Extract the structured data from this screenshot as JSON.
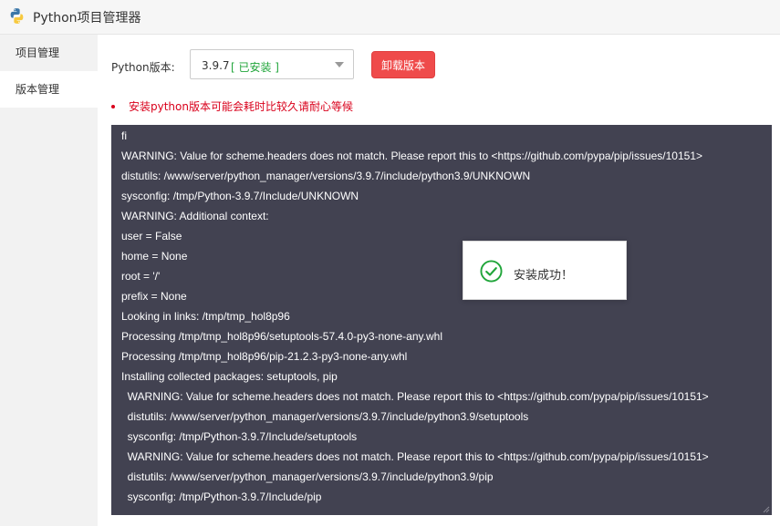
{
  "window": {
    "title": "Python项目管理器",
    "icon": "python-logo-icon"
  },
  "sidebar": {
    "items": [
      {
        "label": "项目管理",
        "active": false
      },
      {
        "label": "版本管理",
        "active": true
      }
    ]
  },
  "version_control": {
    "label": "Python版本:",
    "selected_version": "3.9.7",
    "selected_status": "[ 已安装 ]",
    "status_color": "#20a53a",
    "uninstall_label": "卸载版本",
    "uninstall_color": "#ef4b4b"
  },
  "notice": {
    "text": "安装python版本可能会耗时比较久请耐心等候",
    "color": "#d9001b"
  },
  "log": {
    "background": "#424251",
    "lines": [
      "fi",
      "WARNING: Value for scheme.headers does not match. Please report this to <https://github.com/pypa/pip/issues/10151>",
      "distutils: /www/server/python_manager/versions/3.9.7/include/python3.9/UNKNOWN",
      "sysconfig: /tmp/Python-3.9.7/Include/UNKNOWN",
      "WARNING: Additional context:",
      "user = False",
      "home = None",
      "root = '/'",
      "prefix = None",
      "Looking in links: /tmp/tmp_hol8p96",
      "Processing /tmp/tmp_hol8p96/setuptools-57.4.0-py3-none-any.whl",
      "Processing /tmp/tmp_hol8p96/pip-21.2.3-py3-none-any.whl",
      "Installing collected packages: setuptools, pip",
      "  WARNING: Value for scheme.headers does not match. Please report this to <https://github.com/pypa/pip/issues/10151>",
      "  distutils: /www/server/python_manager/versions/3.9.7/include/python3.9/setuptools",
      "  sysconfig: /tmp/Python-3.9.7/Include/setuptools",
      "  WARNING: Value for scheme.headers does not match. Please report this to <https://github.com/pypa/pip/issues/10151>",
      "  distutils: /www/server/python_manager/versions/3.9.7/include/python3.9/pip",
      "  sysconfig: /tmp/Python-3.9.7/Include/pip"
    ]
  },
  "toast": {
    "message": "安装成功！",
    "icon": "check-circle-icon",
    "icon_color": "#20a53a"
  }
}
